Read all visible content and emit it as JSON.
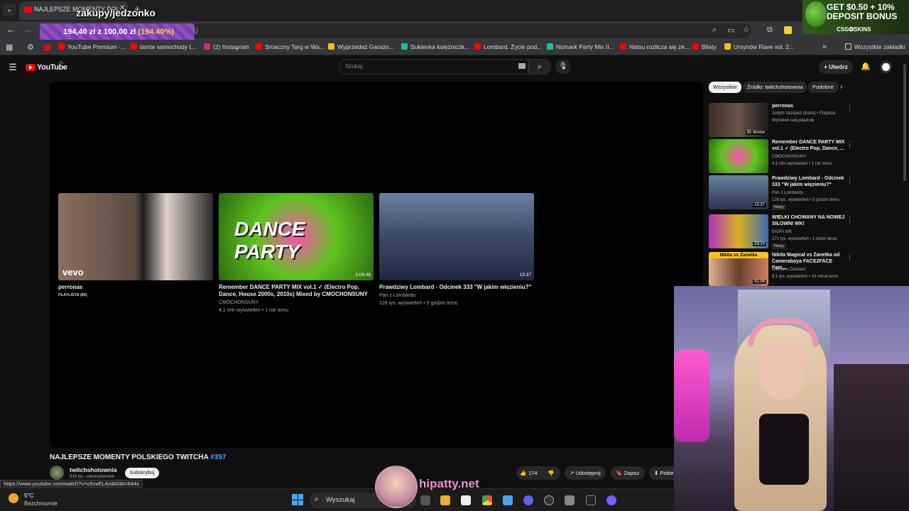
{
  "browser": {
    "tab_title": "NAJLEPSZE MOMENTY POLSK...",
    "overlay_text": "zakupy/jedzonko",
    "price_overlay": {
      "prefix": "194,40 zł z 100,00 zł",
      "percent": "(194.40%)"
    },
    "omnibox_query": "Q",
    "bookmarks": [
      {
        "label": "YouTube Premium -...",
        "color": "#ff0000"
      },
      {
        "label": "tamte samochody t...",
        "color": "#ff0000"
      },
      {
        "label": "(2) Instagram",
        "color": "#d62976"
      },
      {
        "label": "Smaczny Targ w Wa...",
        "color": "#ff0000"
      },
      {
        "label": "Wyprzedaż Garażo...",
        "color": "#f4c20d"
      },
      {
        "label": "Sukienka księżniczk...",
        "color": "#1abc9c"
      },
      {
        "label": "Lombard. Życie pod...",
        "color": "#ff0000"
      },
      {
        "label": "Numark Party Mix II...",
        "color": "#19c0a0"
      },
      {
        "label": "Natsu rozlicza się ze...",
        "color": "#ff0000"
      },
      {
        "label": "Bilety",
        "color": "#ff0000"
      },
      {
        "label": "Ursynów Rave vol. 2...",
        "color": "#f4c20d"
      }
    ],
    "all_bookmarks": "Wszystkie zakładki",
    "status_url": "https://www.youtube.com/watch?v=o5vxELArdA0&t=644s"
  },
  "ad": {
    "line1": "GET $0.50 + 10%",
    "line2": "DEPOSIT BONUS",
    "brand": "CSG✪SKINS"
  },
  "youtube": {
    "logo": "YouTube",
    "region": "PL",
    "search_placeholder": "Szukaj",
    "create_label": "Utwórz",
    "video_title": "NAJLEPSZE MOMENTY POLSKIEGO TWITCHA",
    "video_tag": "#397",
    "channel_name": "twitchshotownia",
    "channel_subs": "516 tys. subskrybentów",
    "subscribe": "Subskrybuj",
    "likes": "174",
    "share": "Udostępnij",
    "save": "Zapisz",
    "download": "Pobierz"
  },
  "endcards": [
    {
      "title": "perronas",
      "sub1": "PLAYLISTA (85)",
      "sub2": "",
      "duration": ""
    },
    {
      "title": "Remember DANCE PARTY MIX vol.1 ✓ (Electro Pop, Dance, House 2000s, 2010s) Mixed by CMOCHONSUNY",
      "sub1": "CMOCHONSUNY",
      "sub2": "4,1 mln wyświetleń • 1 rok temu",
      "duration": "2:09:46"
    },
    {
      "title": "Prawdziwy Lombard - Odcinek 333 \"W jakim więzieniu?\"",
      "sub1": "Pan z Lombardu",
      "sub2": "128 tys. wyświetleń • 5 godzin temu",
      "duration": "15:37"
    }
  ],
  "chips": [
    "Wszystkie",
    "Źródło: twitchshotownia",
    "Podobne"
  ],
  "sidebar": [
    {
      "title": "perronas",
      "meta1": "Judyth Vazquez (Keka) • Playlista",
      "meta2": "Wyświetl całą playlistę",
      "badge": "",
      "duration": "85 filmów",
      "color": "#555"
    },
    {
      "title": "Remember DANCE PARTY MIX vol.1 ✓ (Electro Pop, Dance, ...",
      "meta1": "CMOCHONSUNY",
      "meta2": "4,1 mln wyświetleń • 1 rok temu",
      "badge": "",
      "duration": "",
      "color": "#4caf20"
    },
    {
      "title": "Prawdziwy Lombard - Odcinek 333 \"W jakim więzieniu?\"",
      "meta1": "Pan z Lombardu",
      "meta2": "128 tys. wyświetleń • 5 godzin temu",
      "badge": "Nowy",
      "duration": "15:37",
      "color": "#3a5a8a"
    },
    {
      "title": "WIELKI CHOWANY NA NOWEJ SIŁOWNI WK!",
      "meta1": "EKIPA WK",
      "meta2": "171 tys. wyświetleń • 1 dzień temu",
      "badge": "Nowy",
      "duration": "29:10",
      "color": "#c0a020"
    },
    {
      "title": "Nikita Magical vs Żanetka od Cameraboya FACE2FACE Fam...",
      "meta1": "Damiano Damiani",
      "meta2": "8,1 tys. wyświetleń • 19 minut temu",
      "badge": "",
      "duration": "41:04",
      "color": "#c08050",
      "banner": "Nikita vs Żanetka"
    }
  ],
  "taskbar": {
    "temp": "5°C",
    "weather": "Bezchmurnie",
    "search": "Wyszukaj"
  },
  "watermark": "hipatty.net"
}
